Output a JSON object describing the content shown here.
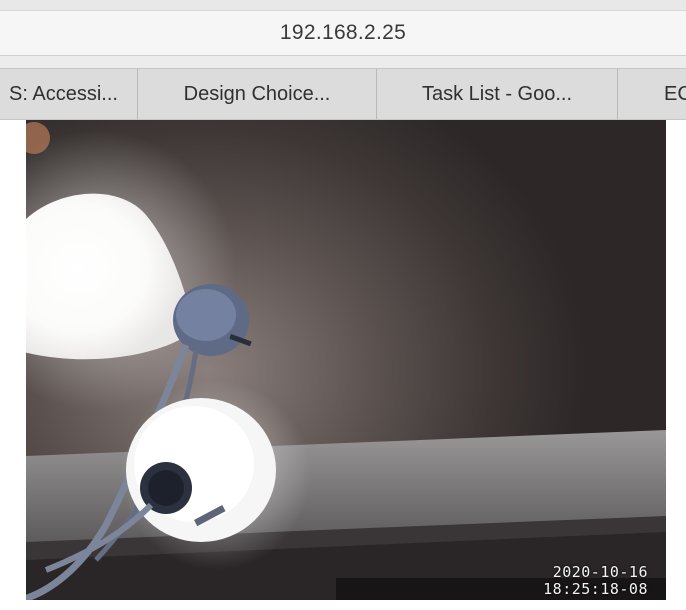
{
  "browser": {
    "address": "192.168.2.25",
    "tabs": [
      {
        "label": "S: Accessi..."
      },
      {
        "label": "Design Choice..."
      },
      {
        "label": "Task List - Goo..."
      },
      {
        "label": "EC"
      }
    ]
  },
  "camera": {
    "date": "2020-10-16",
    "time": "18:25:18-08"
  }
}
